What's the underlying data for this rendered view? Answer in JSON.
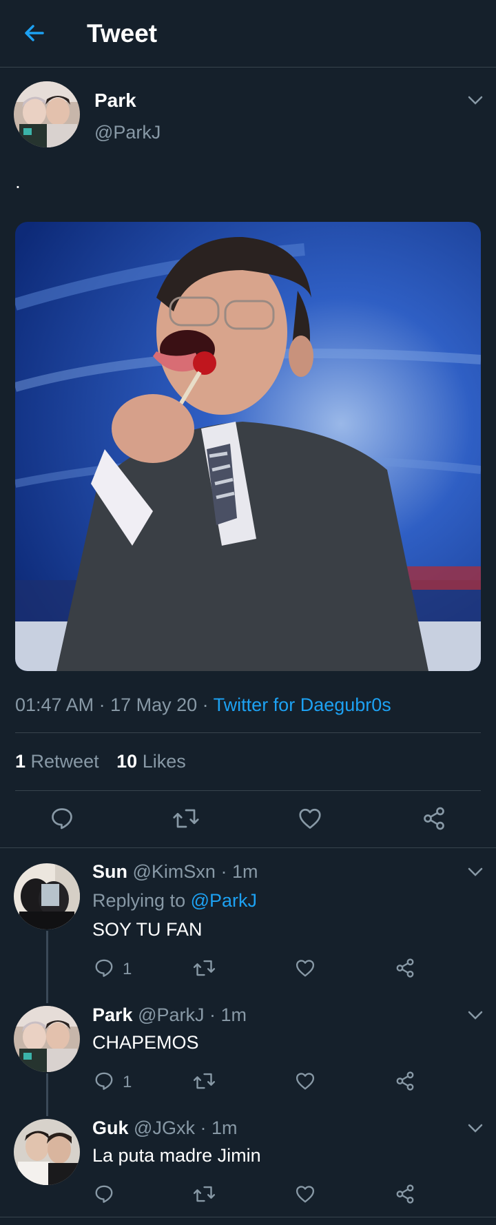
{
  "header": {
    "title": "Tweet"
  },
  "tweet": {
    "author_name": "Park",
    "author_handle": "@ParkJ",
    "text": ".",
    "time": "01:47 AM",
    "date": "17 May 20",
    "source": "Twitter for Daegubr0s",
    "retweet_count": "1",
    "retweet_label": "Retweet",
    "like_count": "10",
    "like_label": "Likes"
  },
  "replies": [
    {
      "name": "Sun",
      "handle": "@KimSxn",
      "time": "1m",
      "replying_label": "Replying to",
      "replying_handle": "@ParkJ",
      "text": "SOY TU FAN",
      "reply_count": "1"
    },
    {
      "name": "Park",
      "handle": "@ParkJ",
      "time": "1m",
      "text": "CHAPEMOS",
      "reply_count": "1"
    },
    {
      "name": "Guk",
      "handle": "@JGxk",
      "time": "1m",
      "text": "La puta madre Jimin"
    }
  ],
  "separator": " · ",
  "colors": {
    "background": "#15202b",
    "accent": "#1da1f2",
    "muted": "#8899a6",
    "border": "#38444d"
  },
  "icons": [
    "back-arrow-icon",
    "chevron-down-icon",
    "reply-icon",
    "retweet-icon",
    "like-icon",
    "share-icon"
  ]
}
